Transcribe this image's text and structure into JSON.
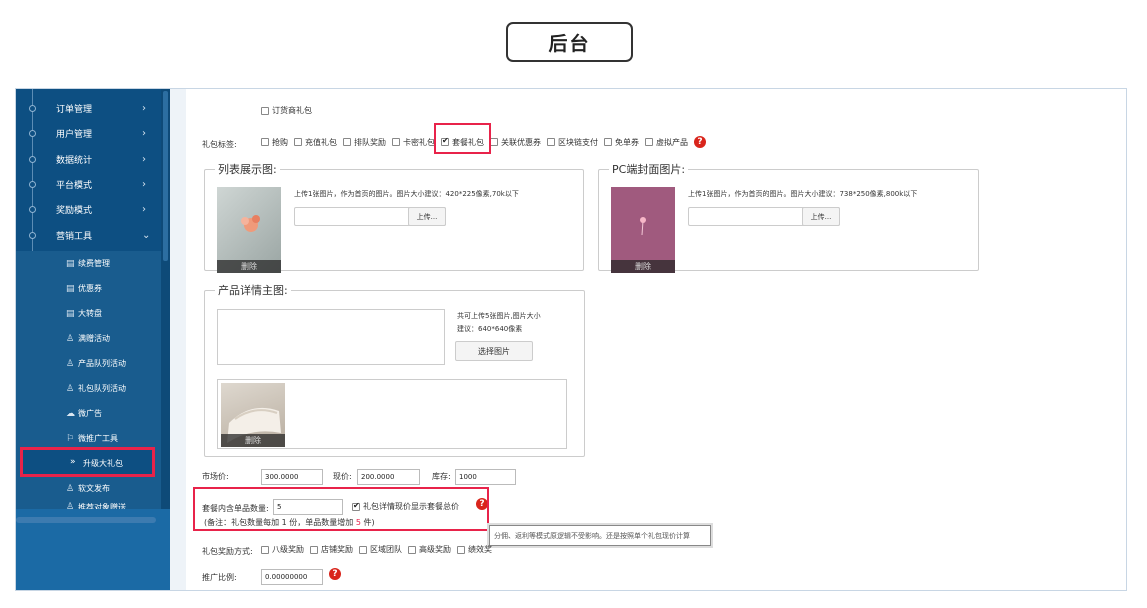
{
  "badge": "后台",
  "sidebar": {
    "menu": [
      {
        "label": "订单管理",
        "arrow": "›"
      },
      {
        "label": "用户管理",
        "arrow": "›"
      },
      {
        "label": "数据统计",
        "arrow": "›"
      },
      {
        "label": "平台模式",
        "arrow": "›"
      },
      {
        "label": "奖励模式",
        "arrow": "›"
      },
      {
        "label": "营销工具",
        "arrow": "⌄"
      }
    ],
    "submenu": [
      {
        "icon": "▤",
        "label": "续费管理"
      },
      {
        "icon": "▤",
        "label": "优惠券"
      },
      {
        "icon": "▤",
        "label": "大转盘"
      },
      {
        "icon": "♙",
        "label": "满赠活动"
      },
      {
        "icon": "♙",
        "label": "产品队列活动"
      },
      {
        "icon": "♙",
        "label": "礼包队列活动"
      },
      {
        "icon": "☁",
        "label": "微广告"
      },
      {
        "icon": "⚐",
        "label": "微推广工具"
      }
    ],
    "active": {
      "icon": "»",
      "label": "升级大礼包"
    },
    "after": [
      {
        "icon": "♙",
        "label": "软文发布"
      },
      {
        "icon": "♙",
        "label": "推荐对象赠送"
      }
    ]
  },
  "content": {
    "order_gift_label": "订货商礼包",
    "tags_label": "礼包标签:",
    "tags": [
      {
        "label": "抢购",
        "checked": false
      },
      {
        "label": "充值礼包",
        "checked": false
      },
      {
        "label": "排队奖励",
        "checked": false
      },
      {
        "label": "卡密礼包",
        "checked": false
      },
      {
        "label": "套餐礼包",
        "checked": true
      },
      {
        "label": "关联优惠券",
        "checked": false
      },
      {
        "label": "区块链支付",
        "checked": false
      },
      {
        "label": "免单券",
        "checked": false
      },
      {
        "label": "虚拟产品",
        "checked": false
      }
    ],
    "help_icon": "?",
    "list_image": {
      "legend": "列表展示图:",
      "note": "上传1张图片，作为首页的图片。图片大小建议：420*225像素,70k以下",
      "upload_btn": "上传...",
      "delete": "删除"
    },
    "pc_image": {
      "legend": "PC端封面图片:",
      "note": "上传1张图片，作为首页的图片。图片大小建议：738*250像素,800k以下",
      "upload_btn": "上传...",
      "delete": "删除"
    },
    "detail_image": {
      "legend": "产品详情主图:",
      "note_line1": "共可上传5张图片,图片大小",
      "note_line2": "建议：640*640像素",
      "select_btn": "选择图片",
      "delete": "删除"
    },
    "prices": {
      "market_label": "市场价:",
      "market_value": "300.0000",
      "current_label": "现价:",
      "current_value": "200.0000",
      "stock_label": "库存:",
      "stock_value": "1000"
    },
    "package": {
      "qty_label": "套餐内含单品数量:",
      "qty_value": "5",
      "show_total_label": "礼包详情现价显示套餐总价",
      "note_prefix": "(备注：礼包数量每加 1 份，单品数量增加 ",
      "note_num": "5",
      "note_suffix": " 件)"
    },
    "tooltip": "分佣、返利等模式原逻辑不受影响。还是按照单个礼包现价计算",
    "reward_label": "礼包奖励方式:",
    "rewards": [
      {
        "label": "八级奖励",
        "checked": false
      },
      {
        "label": "店铺奖励",
        "checked": false
      },
      {
        "label": "区域团队",
        "checked": false
      },
      {
        "label": "高级奖励",
        "checked": false
      },
      {
        "label": "绩效奖",
        "checked": false
      }
    ],
    "promo_label": "推广比例:",
    "promo_value": "0.00000000"
  },
  "colors": {
    "sidebar": "#0d4f82",
    "highlight": "#e8234a",
    "help": "#d9251c"
  }
}
